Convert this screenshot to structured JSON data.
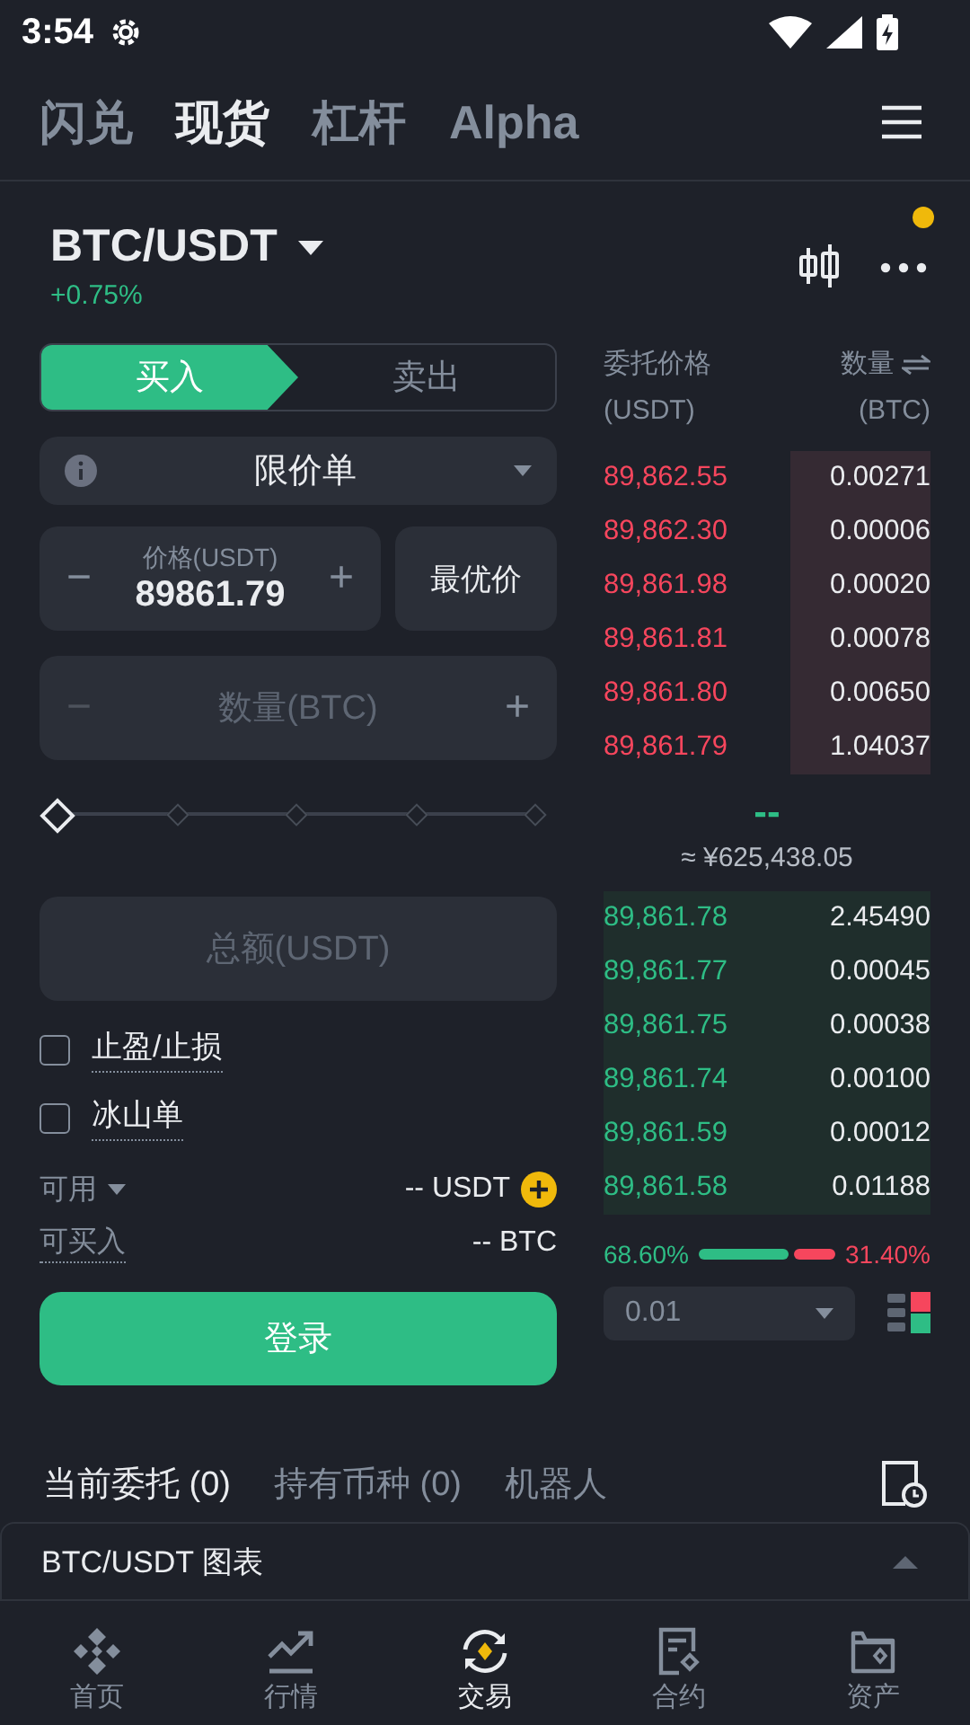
{
  "status_bar": {
    "time": "3:54"
  },
  "top_tabs": [
    {
      "label": "闪兑",
      "selected": false
    },
    {
      "label": "现货",
      "selected": true
    },
    {
      "label": "杠杆",
      "selected": false
    },
    {
      "label": "Alpha",
      "selected": false
    }
  ],
  "pair": {
    "symbol": "BTC/USDT",
    "change": "+0.75%",
    "notification": true
  },
  "side_toggle": [
    {
      "label": "买入",
      "selected": true
    },
    {
      "label": "卖出",
      "selected": false
    }
  ],
  "order_type": "限价单",
  "price_field": {
    "label": "价格(USDT)",
    "value": "89861.79",
    "minus": "−",
    "plus": "+"
  },
  "best_price_button": "最优价",
  "amount_field": {
    "placeholder": "数量(BTC)",
    "minus": "−",
    "plus": "+"
  },
  "amount_slider": {
    "level": 0
  },
  "total_field": {
    "placeholder": "总额(USDT)"
  },
  "options": [
    {
      "label": "止盈/止损",
      "checked": false
    },
    {
      "label": "冰山单",
      "checked": false
    }
  ],
  "available": {
    "label": "可用",
    "value": "-- USDT"
  },
  "buyable": {
    "label": "可买入",
    "value": "-- BTC"
  },
  "login_button": "登录",
  "order_book": {
    "price_header": "委托价格",
    "price_unit": "(USDT)",
    "amount_header": "数量",
    "amount_unit": "(BTC)",
    "asks": [
      {
        "price": "89,862.55",
        "amount": "0.00271"
      },
      {
        "price": "89,862.30",
        "amount": "0.00006"
      },
      {
        "price": "89,861.98",
        "amount": "0.00020"
      },
      {
        "price": "89,861.81",
        "amount": "0.00078"
      },
      {
        "price": "89,861.80",
        "amount": "0.00650"
      },
      {
        "price": "89,861.79",
        "amount": "1.04037"
      }
    ],
    "last_price": "--",
    "fiat_price": "≈ ¥625,438.05",
    "bids": [
      {
        "price": "89,861.78",
        "amount": "2.45490"
      },
      {
        "price": "89,861.77",
        "amount": "0.00045"
      },
      {
        "price": "89,861.75",
        "amount": "0.00038"
      },
      {
        "price": "89,861.74",
        "amount": "0.00100"
      },
      {
        "price": "89,861.59",
        "amount": "0.00012"
      },
      {
        "price": "89,861.58",
        "amount": "0.01188"
      }
    ],
    "buy_ratio": {
      "level": 0.686,
      "buy_label": "68.60%",
      "sell_label": "31.40%"
    },
    "precision": "0.01"
  },
  "bottom_tabs": [
    {
      "label": "当前委托 (0)",
      "selected": true
    },
    {
      "label": "持有币种 (0)",
      "selected": false
    },
    {
      "label": "机器人",
      "selected": false
    }
  ],
  "chart_bar": {
    "title": "BTC/USDT 图表"
  },
  "nav": [
    {
      "label": "首页",
      "selected": false,
      "kind": "home"
    },
    {
      "label": "行情",
      "selected": false,
      "kind": "markets"
    },
    {
      "label": "交易",
      "selected": true,
      "kind": "trade"
    },
    {
      "label": "合约",
      "selected": false,
      "kind": "futures"
    },
    {
      "label": "资产",
      "selected": false,
      "kind": "wallet"
    }
  ]
}
